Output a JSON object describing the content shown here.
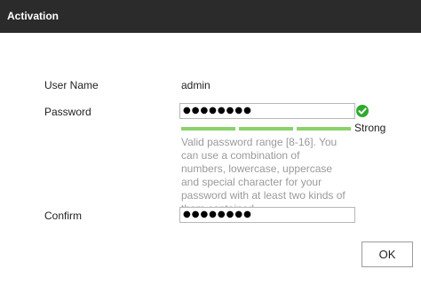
{
  "dialog": {
    "title": "Activation"
  },
  "form": {
    "username_label": "User Name",
    "username_value": "admin",
    "password_label": "Password",
    "password_value": "●●●●●●●●",
    "confirm_label": "Confirm",
    "confirm_value": "●●●●●●●●",
    "strength_text": "Strong",
    "strength_level": "3/3",
    "hint": "Valid password range [8-16]. You can use a combination of numbers, lowercase, uppercase and special character for your password with at least two kinds of them contained."
  },
  "buttons": {
    "ok_label": "OK"
  },
  "colors": {
    "titlebar": "#2b2b2b",
    "strength_bar": "#8bd16b",
    "check": "#2eaa2e",
    "hint_text": "#9a9a9a"
  },
  "icons": {
    "valid": "check-circle-icon"
  }
}
